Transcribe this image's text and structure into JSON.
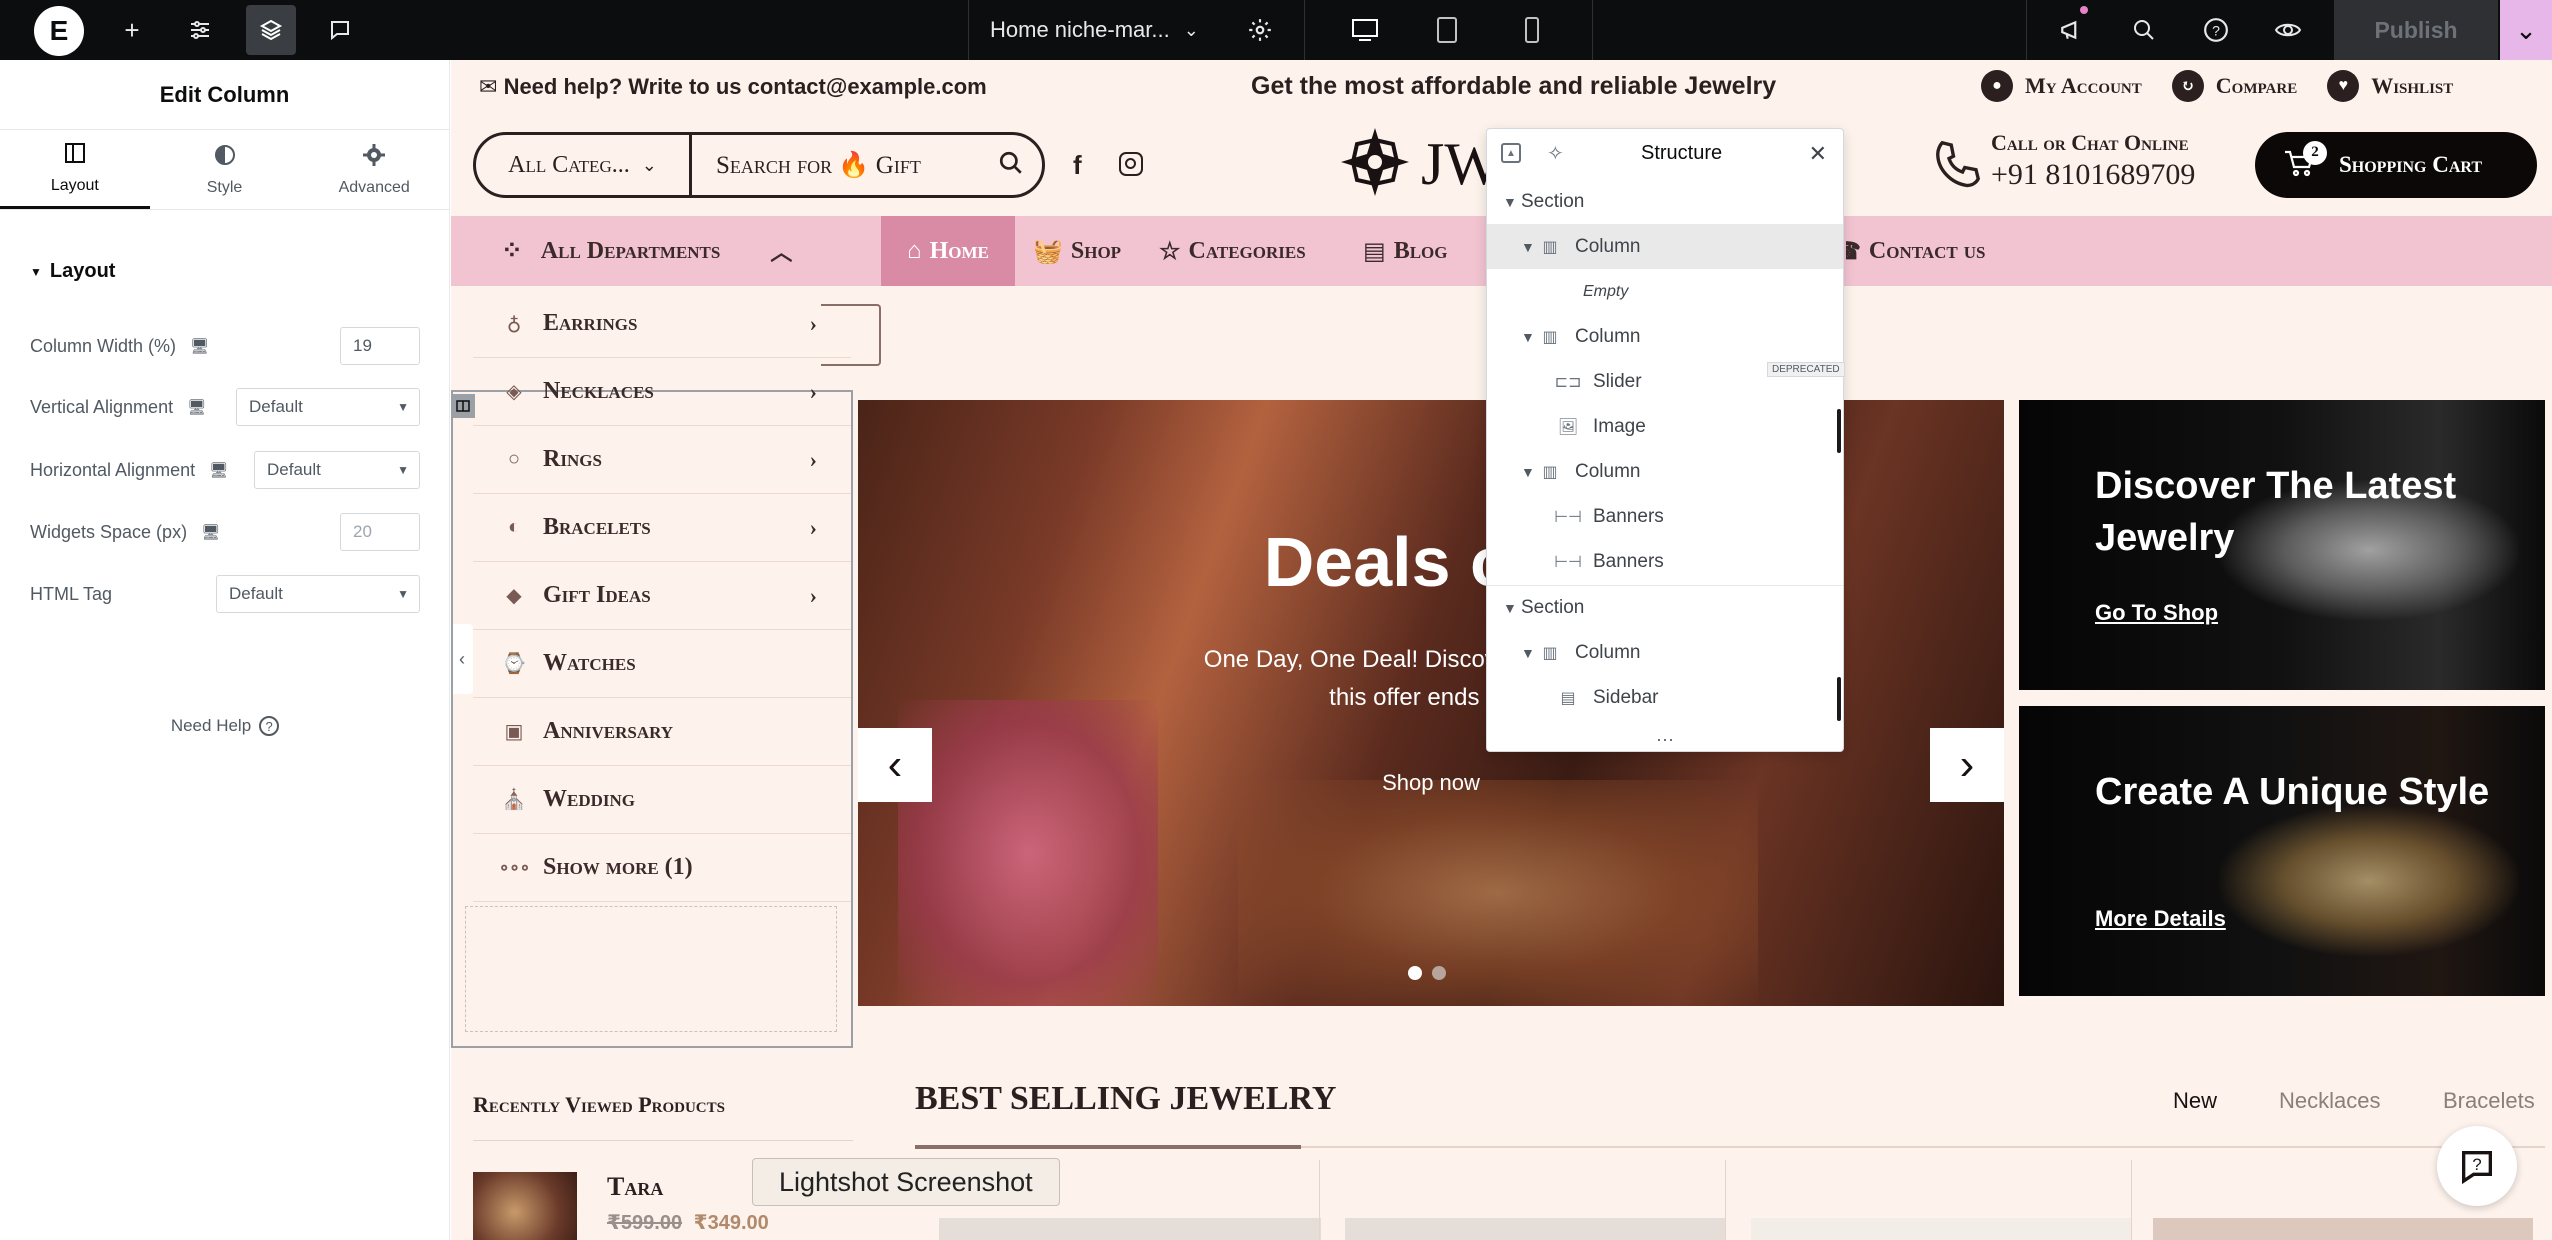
{
  "topbar": {
    "page_name": "Home niche-mar...",
    "publish_label": "Publish"
  },
  "sidebar": {
    "title": "Edit Column",
    "tabs": [
      {
        "label": "Layout",
        "icon": "layout-icon"
      },
      {
        "label": "Style",
        "icon": "style-half-circle-icon"
      },
      {
        "label": "Advanced",
        "icon": "gear-icon"
      }
    ],
    "section_title": "Layout",
    "controls": {
      "column_width": {
        "label": "Column Width (%)",
        "value": "19"
      },
      "vertical_alignment": {
        "label": "Vertical Alignment",
        "value": "Default"
      },
      "horizontal_alignment": {
        "label": "Horizontal Alignment",
        "value": "Default"
      },
      "widgets_space": {
        "label": "Widgets Space (px)",
        "value": "20"
      },
      "html_tag": {
        "label": "HTML Tag",
        "value": "Default"
      }
    },
    "need_help": "Need Help"
  },
  "site": {
    "help_text": "Need help? Write to us contact@example.com",
    "promo": "Get the most affordable and reliable Jewelry",
    "account_links": [
      "My Account",
      "Compare",
      "Wishlist"
    ],
    "category_select": "All Categ...",
    "search_placeholder": "Search for 🔥 Gift",
    "logo_text": "JW",
    "call_label": "Call or Chat Online",
    "phone": "+91 8101689709",
    "cart_label": "Shopping Cart",
    "cart_count": "2",
    "dept_label": "All Departments",
    "nav": [
      "Home",
      "Shop",
      "Categories",
      "Blog",
      "Contact us"
    ],
    "departments": [
      {
        "label": "Earrings",
        "has_arrow": true
      },
      {
        "label": "Necklaces",
        "has_arrow": true
      },
      {
        "label": "Rings",
        "has_arrow": true
      },
      {
        "label": "Bracelets",
        "has_arrow": true
      },
      {
        "label": "Gift Ideas",
        "has_arrow": true
      },
      {
        "label": "Watches",
        "has_arrow": false
      },
      {
        "label": "Anniversary",
        "has_arrow": false
      },
      {
        "label": "Wedding",
        "has_arrow": false
      },
      {
        "label": "Show more (1)",
        "has_arrow": false
      }
    ],
    "slider": {
      "heading": "Deals of tl",
      "line1": "One Day, One Deal! Discover stunning jew",
      "line2": "this offer ends at m",
      "button": "Shop now"
    },
    "banners": [
      {
        "title": "Discover The Latest Jewelry",
        "link": "Go To Shop"
      },
      {
        "title": "Create A Unique Style",
        "link": "More Details"
      }
    ],
    "recently_viewed": "Recently Viewed Products",
    "product": {
      "name": "Tara",
      "old_price": "₹599.00",
      "price": "₹349.00"
    },
    "best_selling": "BEST SELLING JEWELRY",
    "filter_tabs": [
      "New",
      "Necklaces",
      "Bracelets"
    ],
    "tooltip": "Lightshot Screenshot"
  },
  "structure": {
    "title": "Structure",
    "deprecated_badge": "DEPRECATED",
    "items": [
      {
        "label": "Section",
        "level": 0,
        "type": "section",
        "expanded": true
      },
      {
        "label": "Column",
        "level": 1,
        "type": "column",
        "expanded": true,
        "selected": true
      },
      {
        "label": "Empty",
        "level": 2,
        "type": "empty"
      },
      {
        "label": "Column",
        "level": 1,
        "type": "column",
        "expanded": true
      },
      {
        "label": "Slider",
        "level": 2,
        "type": "slider"
      },
      {
        "label": "Image",
        "level": 2,
        "type": "image"
      },
      {
        "label": "Column",
        "level": 1,
        "type": "column",
        "expanded": true
      },
      {
        "label": "Banners",
        "level": 2,
        "type": "banners"
      },
      {
        "label": "Banners",
        "level": 2,
        "type": "banners"
      },
      {
        "label": "Section",
        "level": 0,
        "type": "section",
        "expanded": true
      },
      {
        "label": "Column",
        "level": 1,
        "type": "column",
        "expanded": true
      },
      {
        "label": "Sidebar",
        "level": 2,
        "type": "sidebar"
      }
    ]
  },
  "colors": {
    "accent": "#0c0d0e",
    "nav_bg": "#f2c4d2",
    "active_nav": "#d98ba5",
    "canvas_bg": "#fdf3ec",
    "publish_bg": "#3a3d41"
  }
}
